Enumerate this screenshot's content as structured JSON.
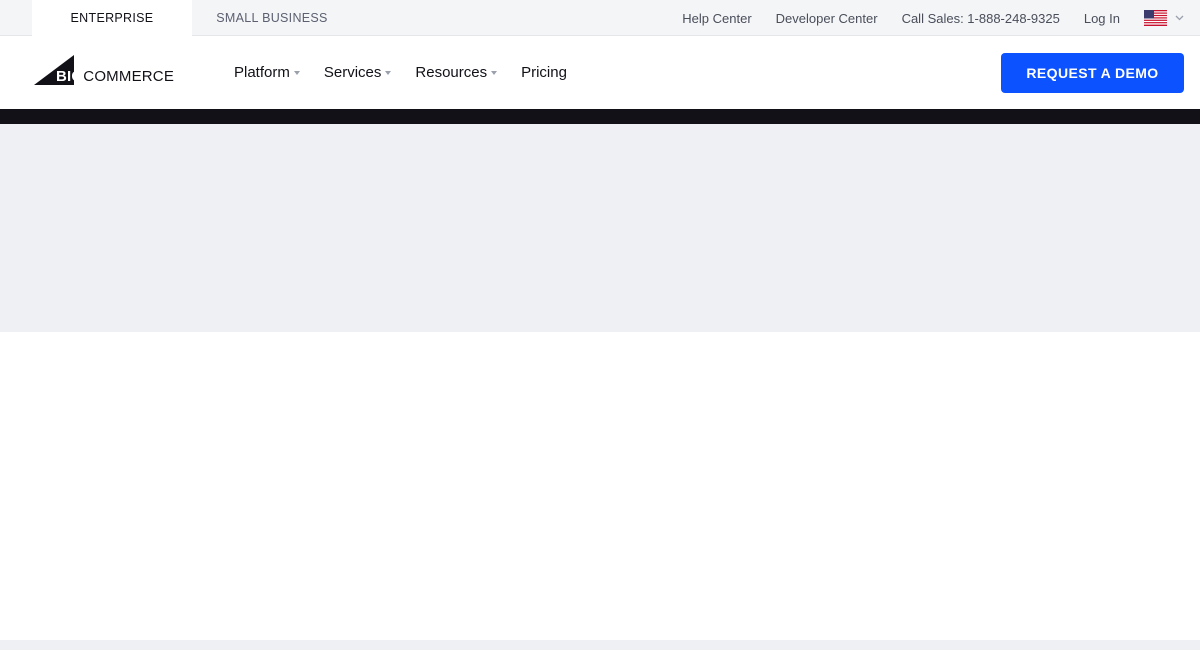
{
  "utility_bar": {
    "tabs": [
      {
        "label": "ENTERPRISE",
        "active": true
      },
      {
        "label": "SMALL BUSINESS",
        "active": false
      }
    ],
    "links": {
      "help": "Help Center",
      "developer": "Developer Center",
      "sales": "Call Sales: 1-888-248-9325",
      "login": "Log In"
    },
    "locale_icon": "us-flag-icon"
  },
  "main_nav": {
    "logo": {
      "big": "BIG",
      "commerce": "COMMERCE"
    },
    "items": [
      {
        "label": "Platform",
        "has_dropdown": true
      },
      {
        "label": "Services",
        "has_dropdown": true
      },
      {
        "label": "Resources",
        "has_dropdown": true
      },
      {
        "label": "Pricing",
        "has_dropdown": false
      }
    ],
    "cta_label": "REQUEST A DEMO"
  },
  "colors": {
    "accent": "#0d52ff",
    "dark": "#121118",
    "placeholder": "#eff0f3"
  }
}
